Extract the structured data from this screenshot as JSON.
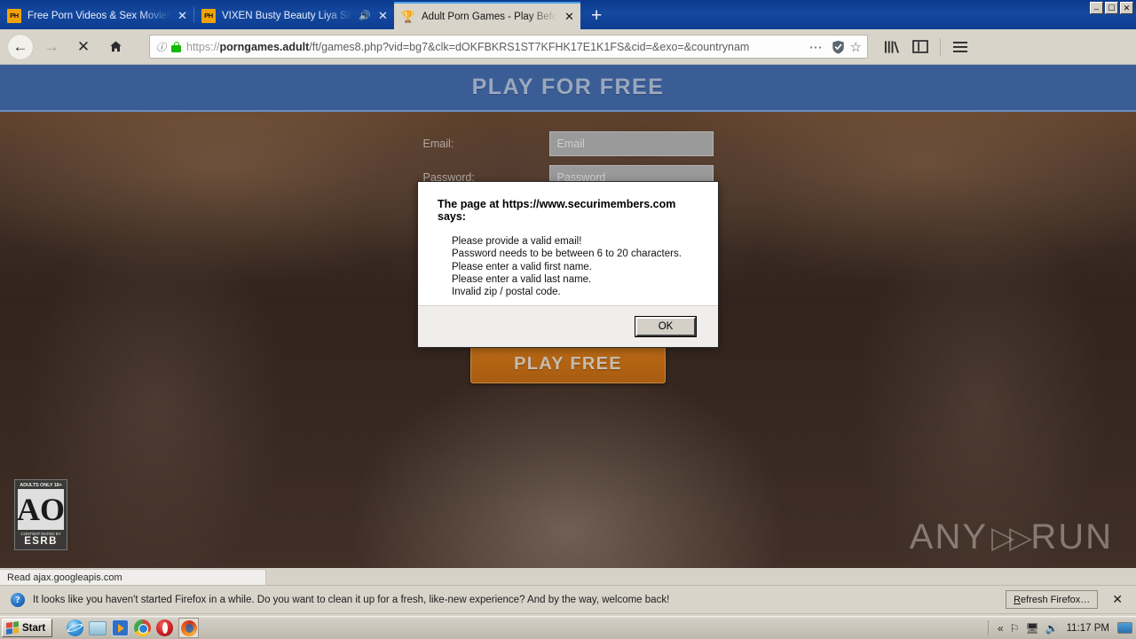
{
  "window": {
    "minimize_label": "_",
    "restore_label": "❐",
    "close_label": "✕"
  },
  "browser": {
    "tabs": [
      {
        "favicon": "ph-logo-icon",
        "title": "Free Porn Videos & Sex Movies - P",
        "muted_icon": "",
        "close_label": "✕",
        "active": false
      },
      {
        "favicon": "ph-logo-icon",
        "title": "VIXEN Busty Beauty Liya Silver",
        "muted_icon": "🔊",
        "close_label": "✕",
        "active": false
      },
      {
        "favicon": "trophy-icon",
        "title": "Adult Porn Games - Play Before Yo",
        "muted_icon": "",
        "close_label": "✕",
        "active": true
      }
    ],
    "new_tab_label": "+",
    "nav": {
      "back_label": "←",
      "forward_label": "→",
      "stop_label": "✕",
      "home_label": "⌂"
    },
    "url": {
      "identity_icon": "info-icon",
      "lock_icon": "lock-icon",
      "scheme": "https://",
      "domain": "porngames.adult",
      "path": "/ft/games8.php?vid=bg7&clk=dOKFBKRS1ST7KFHK17E1K1FS&cid=&exo=&countrynam",
      "page_actions_label": "⋯",
      "shield_icon": "shield-icon",
      "bookmark_label": "☆"
    },
    "toolbar_right": {
      "library_icon": "library-icon",
      "sidebar_icon": "sidebar-icon",
      "menu_icon": "hamburger-menu-icon"
    }
  },
  "page": {
    "header_title": "PLAY FOR FREE",
    "form": {
      "rows": [
        {
          "label": "Email:",
          "placeholder": "Email"
        },
        {
          "label": "Password:",
          "placeholder": "Password"
        }
      ]
    },
    "cta_label": "PLAY FREE",
    "esrb": {
      "top": "ADULTS ONLY 18+",
      "letter": "AO",
      "bottom_1": "CONTENT RATED BY",
      "bottom_2": "ESRB"
    },
    "watermark": {
      "left": "ANY",
      "triangle": "▷",
      "right": "RUN"
    }
  },
  "dialog": {
    "title": "The page at https://www.securimembers.com says:",
    "messages": [
      "Please provide a valid email!",
      "Password needs to be between 6 to 20 characters.",
      "Please enter a valid first name.",
      "Please enter a valid last name.",
      "Invalid zip / postal code."
    ],
    "ok_label": "OK"
  },
  "status": {
    "text": "Read ajax.googleapis.com"
  },
  "notification": {
    "icon": "question-mark-icon",
    "text": "It looks like you haven't started Firefox in a while. Do you want to clean it up for a fresh, like-new experience? And by the way, welcome back!",
    "action_label": "Refresh Firefox…",
    "action_mnemonic": "R",
    "action_rest": "efresh Firefox…",
    "close_label": "✕"
  },
  "taskbar": {
    "start_label": "Start",
    "quick_launch": [
      "internet-explorer-icon",
      "folder-icon",
      "media-player-icon",
      "chrome-icon",
      "opera-icon",
      "firefox-icon"
    ],
    "tray": {
      "expand_label": "«",
      "flag_icon": "flag-icon",
      "network_icon": "network-warning-icon",
      "volume_icon": "volume-icon",
      "clock": "11:17 PM",
      "monitor_icon": "display-icon"
    }
  },
  "colors": {
    "tabstrip": "#0e4397",
    "chrome": "#d8d4ca",
    "site_header": "#3a5d96",
    "cta": "#b0610f",
    "accent_lock": "#12b800"
  }
}
